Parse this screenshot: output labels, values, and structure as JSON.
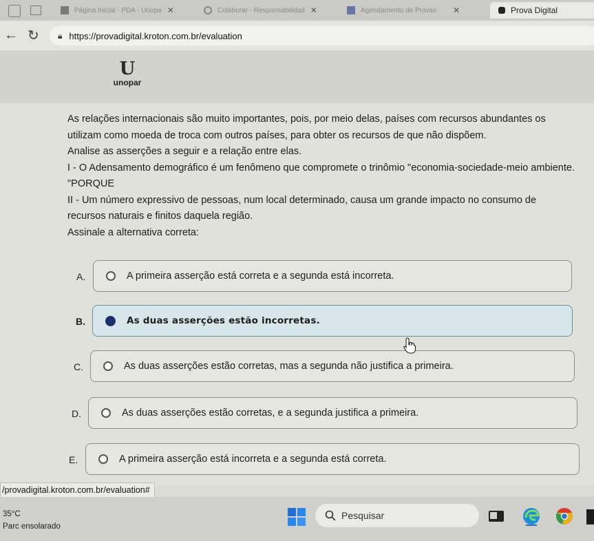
{
  "browser": {
    "tabs": [
      {
        "label": "Página Inicial - PDA - Unopa"
      },
      {
        "label": "Colaborar - Responsabilidad"
      },
      {
        "label": "Agendamento de Provas"
      },
      {
        "label": "Prova Digital"
      }
    ],
    "url": "https://provadigital.kroton.com.br/evaluation",
    "status_url": "/provadigital.kroton.com.br/evaluation#"
  },
  "header": {
    "logo_letter": "U",
    "logo_name": "unopar"
  },
  "question": {
    "paragraphs": [
      "As relações internacionais são muito importantes, pois, por meio delas, países com recursos abundantes os utilizam como moeda de troca com outros países, para obter os recursos de que não dispõem.",
      "Analise as asserções a seguir e a relação entre elas.",
      "I - O Adensamento demográfico é um fenômeno que compromete o trinômio \"economia-sociedade-meio ambiente.",
      "\"PORQUE",
      "II - Um número expressivo de pessoas, num local determinado, causa um grande impacto no consumo de recursos naturais e finitos daquela região.",
      "Assinale a alternativa correta:"
    ]
  },
  "options": [
    {
      "letter": "A.",
      "text": "A primeira asserção está correta e a segunda está incorreta."
    },
    {
      "letter": "B.",
      "text": "As duas asserções estão incorretas."
    },
    {
      "letter": "C.",
      "text": "As duas asserções estão corretas, mas a segunda não justifica a primeira."
    },
    {
      "letter": "D.",
      "text": "As duas asserções estão corretas, e a segunda justifica a primeira."
    },
    {
      "letter": "E.",
      "text": "A primeira asserção está incorreta e a segunda está correta."
    }
  ],
  "selected_option": "B.",
  "taskbar": {
    "temperature": "35°C",
    "weather": "Parc ensolarado",
    "search_label": "Pesquisar"
  },
  "colors": {
    "accent": "#1c2f6b",
    "selected_bg": "#d7e6ea"
  }
}
